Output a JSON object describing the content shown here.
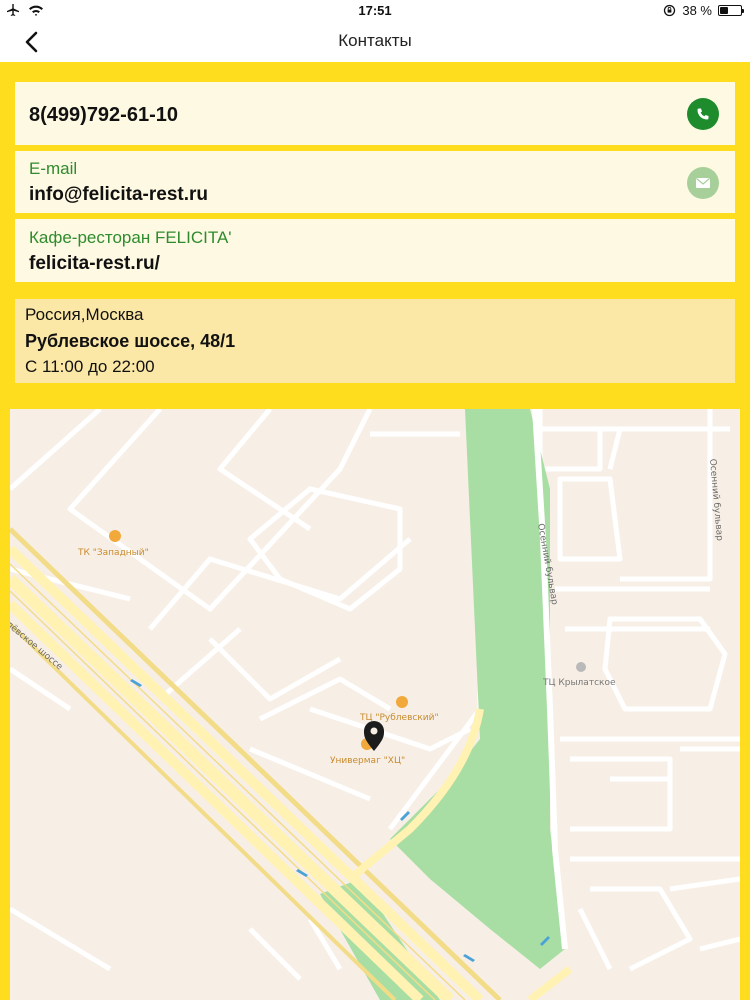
{
  "status_bar": {
    "time": "17:51",
    "battery_text": "38 %",
    "battery_level": 0.38,
    "icons": [
      "airplane-icon",
      "wifi-icon",
      "orientation-lock-icon",
      "battery-icon"
    ]
  },
  "nav": {
    "title": "Контакты",
    "back_icon": "chevron-left-icon"
  },
  "contacts": {
    "phone": {
      "value": "8(499)792-61-10",
      "icon": "phone-icon",
      "icon_color": "#1e8c2d"
    },
    "email": {
      "label": "E-mail",
      "value": "info@felicita-rest.ru",
      "icon": "mail-icon",
      "icon_color": "#a7cf9a"
    },
    "website": {
      "label": "Кафе-ресторан FELICITA'",
      "value": "felicita-rest.ru/"
    }
  },
  "address": {
    "city": "Россия,Москва",
    "street": "Рублевское шоссе, 48/1",
    "hours": "С 11:00 до 22:00"
  },
  "map": {
    "labels": {
      "tk_zapadny": "ТК \"Западный\"",
      "tc_rublevsky": "ТЦ \"Рублевский\"",
      "univermag": "Универмаг \"ХЦ\"",
      "tc_krylatskoe": "ТЦ Крылатское",
      "osenny_1": "Осенний бульвар",
      "osenny_2": "Осенний бульвар",
      "rublevskoe": "лёвское шоссе"
    },
    "pin_icon": "map-pin-icon",
    "colors": {
      "park": "#a8dea3",
      "road": "#fff2b3",
      "background": "#f7efe6"
    }
  },
  "colors": {
    "accent_yellow": "#fedd1f",
    "label_green": "#2e8b2e"
  }
}
